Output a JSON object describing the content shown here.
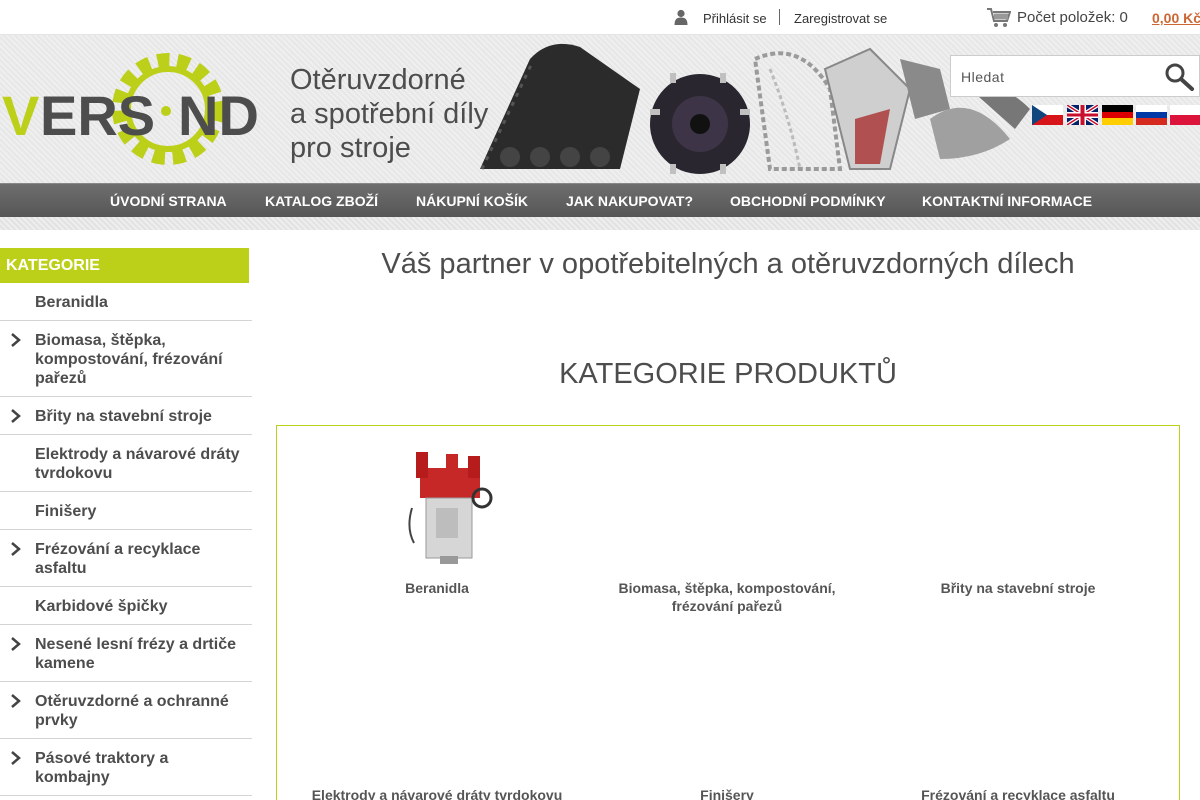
{
  "topbar": {
    "login_label": "Přihlásit se",
    "register_label": "Zaregistrovat se",
    "cart_count_label": "Počet položek: 0",
    "cart_total": "0,00 Kč"
  },
  "header": {
    "logo_text": "VERS ND",
    "slogan": [
      "Otěruvzdorné",
      "a spotřební díly",
      "pro stroje"
    ],
    "search_placeholder": "Hledat",
    "flags": [
      "czech-flag",
      "uk-flag",
      "german-flag",
      "russian-flag",
      "polish-flag"
    ]
  },
  "nav": {
    "items": [
      "ÚVODNÍ STRANA",
      "KATALOG ZBOŽÍ",
      "NÁKUPNÍ KOŠÍK",
      "JAK NAKUPOVAT?",
      "OBCHODNÍ PODMÍNKY",
      "KONTAKTNÍ INFORMACE"
    ]
  },
  "sidebar": {
    "title": "KATEGORIE",
    "items": [
      {
        "label": "Beranidla",
        "arrow": false
      },
      {
        "label": "Biomasa, štěpka, kompostování, frézování pařezů",
        "arrow": true
      },
      {
        "label": "Břity na stavební stroje",
        "arrow": true
      },
      {
        "label": "Elektrody a návarové dráty tvrdokovu",
        "arrow": false
      },
      {
        "label": "Finišery",
        "arrow": false
      },
      {
        "label": "Frézování a recyklace asfaltu",
        "arrow": true
      },
      {
        "label": "Karbidové špičky",
        "arrow": false
      },
      {
        "label": "Nesené lesní frézy a drtiče kamene",
        "arrow": true
      },
      {
        "label": "Otěruvzdorné a ochranné prvky",
        "arrow": true
      },
      {
        "label": "Pásové traktory a kombajny",
        "arrow": true
      },
      {
        "label": "",
        "arrow": false
      }
    ]
  },
  "main": {
    "title": "Váš partner v opotřebitelných a otěruvzdorných dílech",
    "section_title": "KATEGORIE PRODUKTŮ",
    "products": [
      {
        "name": "Beranidla",
        "has_image": true
      },
      {
        "name": "Biomasa, štěpka, kompostování, frézování pařezů",
        "has_image": false
      },
      {
        "name": "Břity na stavební stroje",
        "has_image": false
      },
      {
        "name": "Elektrody a návarové dráty tvrdokovu",
        "has_image": false
      },
      {
        "name": "Finišery",
        "has_image": false
      },
      {
        "name": "Frézování a recyklace asfaltu",
        "has_image": false
      }
    ]
  },
  "colors": {
    "accent_green": "#bccf19",
    "nav_gray": "#5f5f5f",
    "price_orange": "#cc6633",
    "text_gray": "#4d4d4d"
  }
}
